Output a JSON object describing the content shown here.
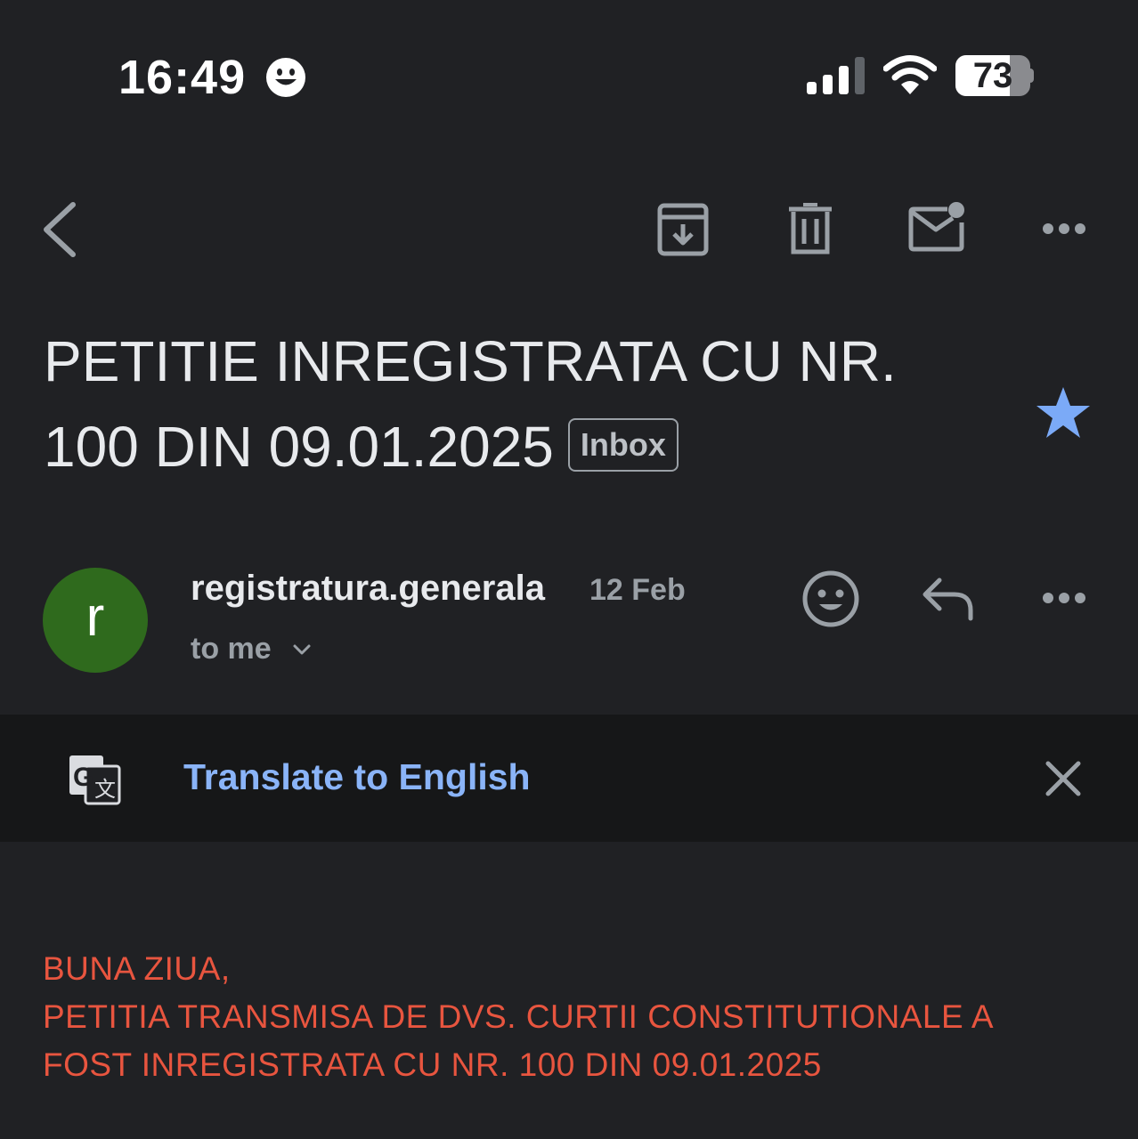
{
  "status_bar": {
    "time": "16:49",
    "status_emoji_icon": "smiley-icon",
    "signal_icon": "cellular-signal-icon",
    "wifi_icon": "wifi-icon",
    "battery_level": "73",
    "battery_fraction": 0.73
  },
  "toolbar": {
    "back_icon": "chevron-left-icon",
    "archive_icon": "archive-icon",
    "delete_icon": "trash-icon",
    "mark_unread_icon": "mail-unread-icon",
    "more_icon": "more-horizontal-icon"
  },
  "email": {
    "subject": "PETITIE INREGISTRATA CU NR. 100 DIN 09.01.2025",
    "label": "Inbox",
    "starred": true,
    "star_color": "#7baaf7",
    "sender": {
      "avatar_letter": "r",
      "avatar_color": "#2f6a1d",
      "name": "registratura.generala",
      "date": "12 Feb",
      "recipient": "to me"
    },
    "body_color": "#e8553f",
    "body_lines": [
      "BUNA ZIUA,",
      "PETITIA TRANSMISA DE DVS. CURTII CONSTITUTIONALE A",
      "FOST INREGISTRATA CU NR. 100 DIN 09.01.2025"
    ]
  },
  "translate_bar": {
    "link_text": "Translate to English",
    "link_color": "#8ab4f8"
  }
}
